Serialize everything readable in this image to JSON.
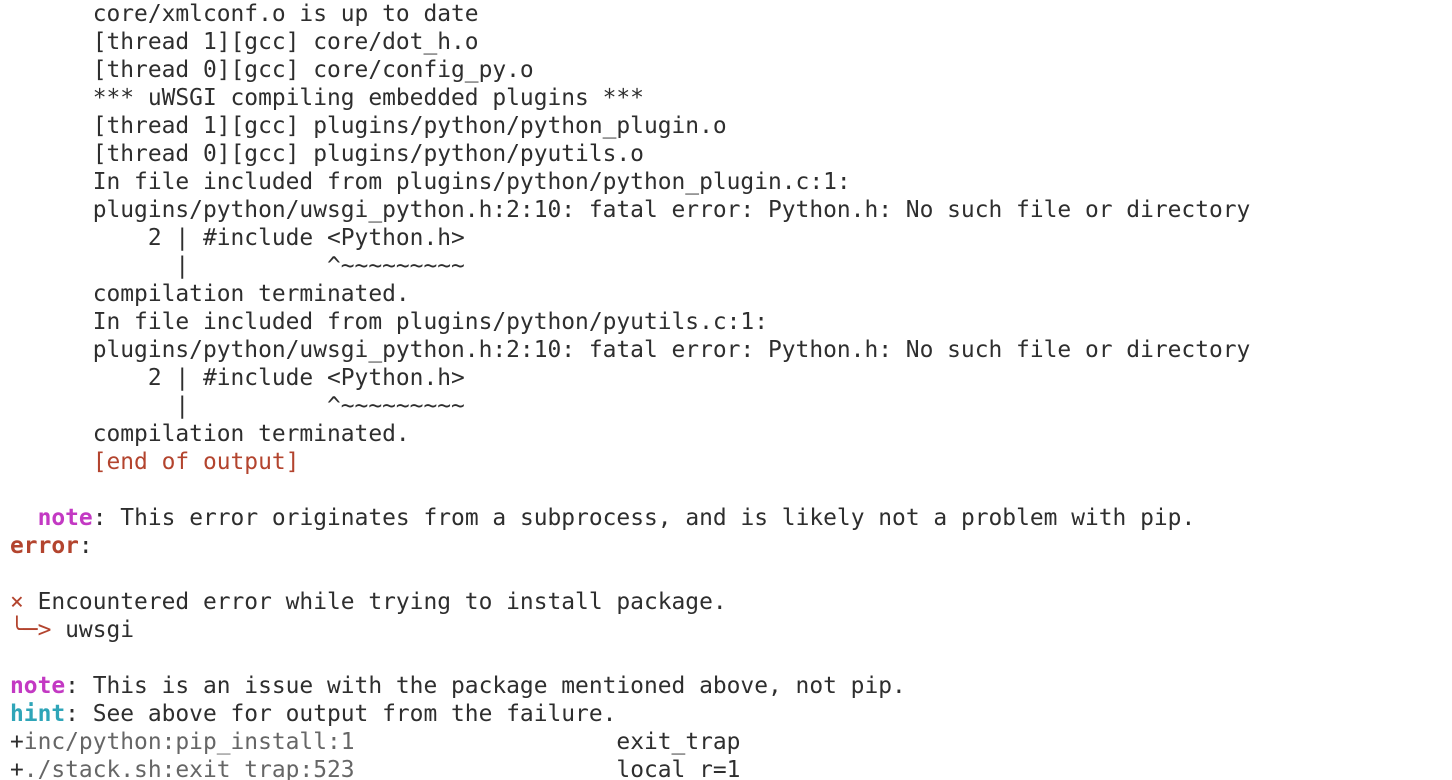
{
  "terminal": {
    "colors": {
      "background": "#ffffff",
      "foreground": "#2e2e2e",
      "error_red": "#b3442e",
      "note_magenta": "#c339c3",
      "hint_cyan": "#2fa5b8",
      "trace_gray": "#666666"
    },
    "build_output": [
      "      core/xmlconf.o is up to date",
      "      [thread 1][gcc] core/dot_h.o",
      "      [thread 0][gcc] core/config_py.o",
      "      *** uWSGI compiling embedded plugins ***",
      "      [thread 1][gcc] plugins/python/python_plugin.o",
      "      [thread 0][gcc] plugins/python/pyutils.o",
      "      In file included from plugins/python/python_plugin.c:1:",
      "      plugins/python/uwsgi_python.h:2:10: fatal error: Python.h: No such file or directory",
      "          2 | #include <Python.h>",
      "            |          ^~~~~~~~~~",
      "      compilation terminated.",
      "      In file included from plugins/python/pyutils.c:1:",
      "      plugins/python/uwsgi_python.h:2:10: fatal error: Python.h: No such file or directory",
      "          2 | #include <Python.h>",
      "            |          ^~~~~~~~~~",
      "      compilation terminated."
    ],
    "end_output": "      [end of output]",
    "note1": {
      "indent": "  ",
      "label": "note",
      "text": ": This error originates from a subprocess, and is likely not a problem with pip."
    },
    "error_line": {
      "label": "error",
      "text": ":"
    },
    "encountered": {
      "icon": "×",
      "text": " Encountered error while trying to install package."
    },
    "package": {
      "arrow": "╰─>",
      "name": " uwsgi"
    },
    "note2": {
      "label": "note",
      "text": ": This is an issue with the package mentioned above, not pip."
    },
    "hint": {
      "label": "hint",
      "text": ": See above for output from the failure."
    },
    "trace": [
      {
        "plus": "+",
        "location": "inc/python:pip_install:1",
        "gap": "                   ",
        "command": "exit_trap"
      },
      {
        "plus": "+",
        "location": "./stack.sh:exit_trap:523",
        "gap": "                   ",
        "command": "local r=1"
      }
    ]
  }
}
